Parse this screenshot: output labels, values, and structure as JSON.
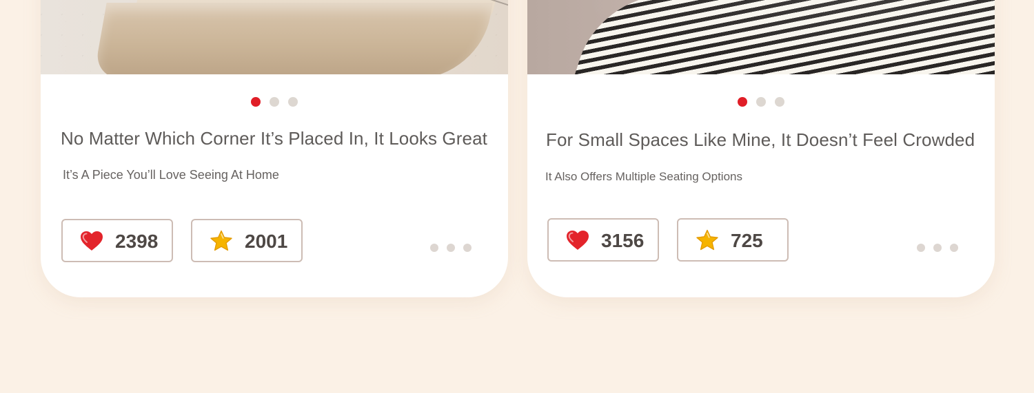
{
  "cards": [
    {
      "title": "No Matter Which Corner It’s Placed In, It Looks Great",
      "subtitle": "It’s A Piece You’ll Love Seeing At Home",
      "likes": "2398",
      "stars": "2001"
    },
    {
      "title": "For Small Spaces Like Mine, It Doesn’t Feel Crowded",
      "subtitle": "It Also Offers Multiple Seating Options",
      "likes": "3156",
      "stars": "725"
    }
  ],
  "colors": {
    "background": "#fbf1e6",
    "accent_red": "#e01e27",
    "text": "#5e5b59",
    "dot_gray": "#ddd7d1",
    "pill_border": "#cdbcb4"
  },
  "icons": {
    "like": "heart-icon",
    "star": "star-icon",
    "more": "more-dots-icon"
  }
}
